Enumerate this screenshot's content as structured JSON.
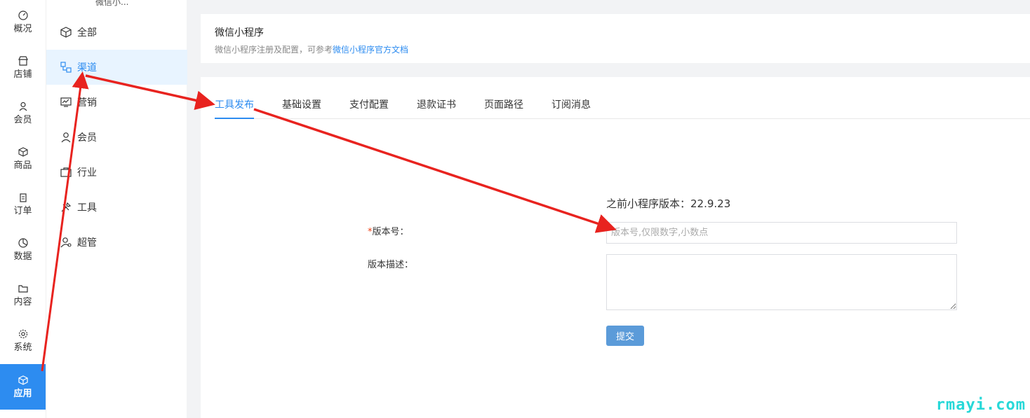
{
  "rail": {
    "items": [
      {
        "label": "概况",
        "icon": "dashboard-icon"
      },
      {
        "label": "店铺",
        "icon": "store-icon"
      },
      {
        "label": "会员",
        "icon": "user-icon"
      },
      {
        "label": "商品",
        "icon": "box-icon"
      },
      {
        "label": "订单",
        "icon": "clipboard-icon"
      },
      {
        "label": "数据",
        "icon": "pie-chart-icon"
      },
      {
        "label": "内容",
        "icon": "folder-icon"
      },
      {
        "label": "系统",
        "icon": "gear-icon"
      },
      {
        "label": "应用",
        "icon": "cube-icon",
        "active": true
      }
    ]
  },
  "menu": {
    "top_label": "微信小...",
    "items": [
      {
        "label": "全部",
        "icon": "cube-icon"
      },
      {
        "label": "渠道",
        "icon": "channel-icon",
        "active": true
      },
      {
        "label": "营销",
        "icon": "chart-monitor-icon"
      },
      {
        "label": "会员",
        "icon": "user-icon"
      },
      {
        "label": "行业",
        "icon": "briefcase-icon"
      },
      {
        "label": "工具",
        "icon": "tools-icon"
      },
      {
        "label": "超管",
        "icon": "admin-icon"
      }
    ]
  },
  "header": {
    "title": "微信小程序",
    "desc_prefix": "微信小程序注册及配置，可参考",
    "desc_link": "微信小程序官方文档"
  },
  "tabs": [
    "工具发布",
    "基础设置",
    "支付配置",
    "退款证书",
    "页面路径",
    "订阅消息"
  ],
  "active_tab": "工具发布",
  "form": {
    "prev_version": "之前小程序版本：22.9.23",
    "version_required_mark": "*",
    "version_label": "版本号：",
    "version_placeholder": "版本号,仅限数字,小数点",
    "version_value": "",
    "desc_label": "版本描述：",
    "desc_value": "",
    "submit_label": "提交"
  },
  "watermark": "rmayi.com",
  "colors": {
    "accent": "#2d8cf0",
    "arrow": "#e8231f",
    "submit": "#5b9bd9",
    "watermark": "#28d8d8"
  }
}
